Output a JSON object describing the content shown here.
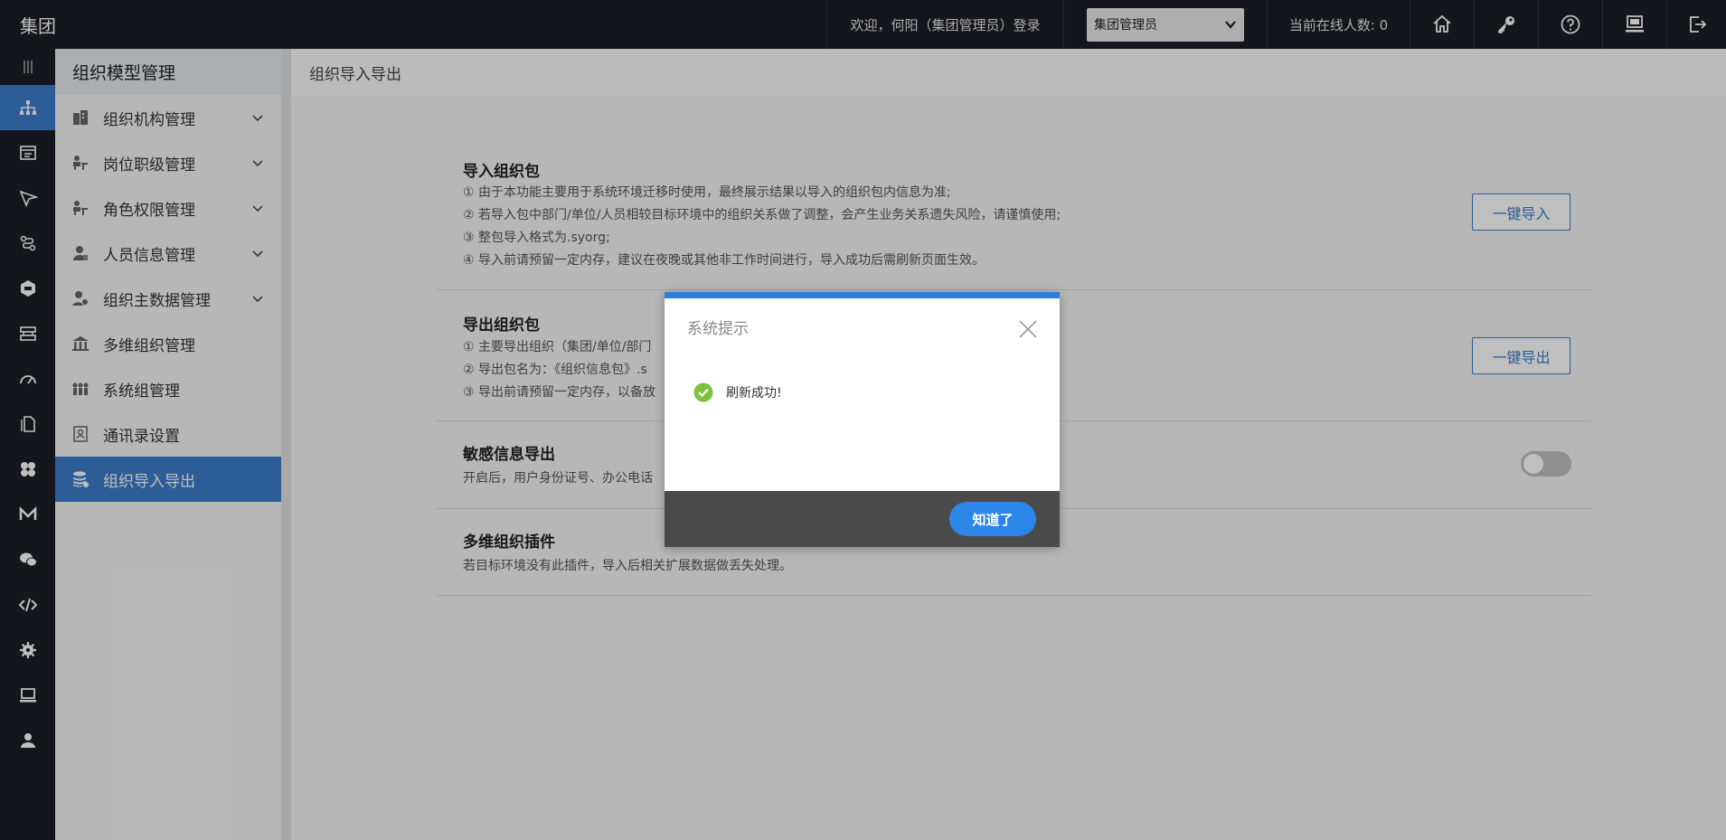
{
  "header": {
    "brand": "集团",
    "welcome": "欢迎，何阳（集团管理员）登录",
    "role_selected": "集团管理员",
    "online": "当前在线人数: 0",
    "icons": [
      "home-icon",
      "key-icon",
      "help-icon",
      "monitor-icon",
      "logout-icon"
    ]
  },
  "rail": {
    "icons": [
      "menu-icon",
      "org-tree-icon",
      "table-icon",
      "send-icon",
      "route-icon",
      "app-icon",
      "server-icon",
      "dashboard-icon",
      "copy-icon",
      "grid-icon",
      "m-icon",
      "chat-icon",
      "code-icon",
      "settings-icon",
      "computer-icon",
      "user-icon"
    ]
  },
  "sidebar": {
    "title": "组织模型管理",
    "items": [
      {
        "label": "组织机构管理"
      },
      {
        "label": "岗位职级管理"
      },
      {
        "label": "角色权限管理"
      },
      {
        "label": "人员信息管理"
      },
      {
        "label": "组织主数据管理"
      },
      {
        "label": "多维组织管理"
      },
      {
        "label": "系统组管理"
      },
      {
        "label": "通讯录设置"
      },
      {
        "label": "组织导入导出"
      }
    ]
  },
  "main": {
    "breadcrumb": "组织导入导出",
    "import": {
      "title": "导入组织包",
      "lines": [
        "① 由于本功能主要用于系统环境迁移时使用，最终展示结果以导入的组织包内信息为准;",
        "② 若导入包中部门/单位/人员相较目标环境中的组织关系做了调整，会产生业务关系遗失风险，请谨慎使用;",
        "③ 整包导入格式为.syorg;",
        "④ 导入前请预留一定内存，建议在夜晚或其他非工作时间进行，导入成功后需刷新页面生效。"
      ],
      "button": "一键导入"
    },
    "export": {
      "title": "导出组织包",
      "lines": [
        "① 主要导出组织（集团/单位/部门",
        "② 导出包名为：《组织信息包》.s",
        "③ 导出前请预留一定内存，以备放"
      ],
      "button": "一键导出"
    },
    "sensitive": {
      "title": "敏感信息导出",
      "desc": "开启后，用户身份证号、办公电话",
      "toggle_on": false
    },
    "plugin": {
      "title": "多维组织插件",
      "desc": "若目标环境没有此插件，导入后相关扩展数据做丢失处理。"
    }
  },
  "dialog": {
    "title": "系统提示",
    "message": "刷新成功!",
    "confirm": "知道了"
  },
  "colors": {
    "accent": "#3d7cc9",
    "dialog_bar": "#2b7fd9",
    "success": "#7cc13a"
  }
}
